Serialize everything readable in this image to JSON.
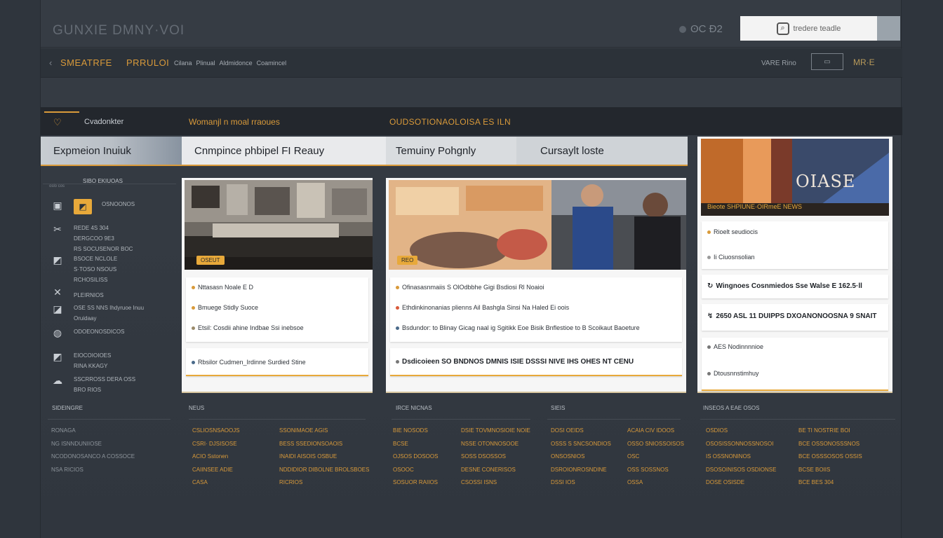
{
  "header": {
    "brand": "GUNXIE DMNY·VOI",
    "status": "ʘC Ð2",
    "search_placeholder": "tredere teadle"
  },
  "nav": {
    "back": "‹",
    "main": "SMEATRFE",
    "secondary": "PRRULOI",
    "links": [
      "Cilana",
      "Plinual",
      "Aldmidonce",
      "Coamincel"
    ],
    "user": "VARE Rino",
    "chip": "▭",
    "right": "MR·E"
  },
  "strip": {
    "title": "Cvadonkter",
    "middle": "Womanjl n moal rraoues",
    "right": "OUDSOTIONAOLOISA ES ILN"
  },
  "tabs": [
    "Expmeion Inuiuk",
    "Cnmpince phbipel FI Reauy",
    "Temuiny Pohgnly",
    "Cursaylt loste"
  ],
  "sidebar": {
    "heading": "SIBO EKIUOAS",
    "sub": "oslo cos",
    "rows": [
      {
        "icon": "image-icon",
        "glyph": "▣",
        "lines": [
          "OSNOONOS"
        ],
        "active": true
      },
      {
        "icon": "tool-icon",
        "glyph": "✂",
        "lines": [
          "REDE 4S 304",
          "DERGCOO 9E3",
          "RS SOCUSENOR BOC"
        ]
      },
      {
        "icon": "flag-icon",
        "glyph": "◩",
        "lines": [
          "BSOCE NCLOLE",
          "S·TOSO NSOUS",
          "RCHOSILISS"
        ]
      },
      {
        "icon": "cross-icon",
        "glyph": "✕",
        "lines": [
          "PLEIRNIOS"
        ]
      },
      {
        "icon": "chart-icon",
        "glyph": "◪",
        "lines": [
          "OSE SS NNS Ihdyruoe Inuu",
          "Oruidaay"
        ]
      },
      {
        "icon": "globe-icon",
        "glyph": "◍",
        "lines": [
          "ODOEONOSDICOS"
        ]
      },
      {
        "icon": "doc-icon",
        "glyph": "◩",
        "lines": [
          "EIOCOIOIOES",
          "RINA KKAGY"
        ]
      },
      {
        "icon": "cloud-icon",
        "glyph": "☁",
        "lines": [
          "SSCRROSS DERA OSS",
          "BRO RIOS"
        ]
      }
    ]
  },
  "cards": [
    {
      "badge": "OSEUT",
      "items": [
        {
          "text": "Nttasasn Noale E  D",
          "bold": false
        },
        {
          "text": "Bmuege Stidly Suoce",
          "bold": false
        },
        {
          "text": "Etsil: Cosdii ahine Indbae  Ssi inebsoe",
          "bold": false
        },
        {
          "text": "Rbsilor  Cudmen_Irdinne Surdied Stine",
          "bold": false
        }
      ]
    },
    {
      "badge": "REO",
      "items": [
        {
          "text": "Ofinasasnmaiis  S  OlOdbbhe  Gigi  Bsdiosi  Rl Noaioi",
          "bold": false
        },
        {
          "text": "Ethdinkinonanias plienns Ail Bashgla  Sinsi Na Haled Ei oois",
          "bold": false
        },
        {
          "text": "Bsdundor: to Blinay  Gicag naal ig  Sgitikk  Eoe Bisik  Bnflestioe to B Scoikaut Baoeture",
          "bold": false
        },
        {
          "text": "Dsdicoieen  SO  BNDNOS DMNIS ISIE DSSSI NIVE  IHS  OHES NT CENU",
          "bold": true
        }
      ]
    },
    {
      "caption": "OIASE",
      "subcaption": "Bieote  SHPIUNE·OIRmeE  NEWS",
      "items": [
        {
          "text": "Rioelt seudiocis",
          "bold": false
        },
        {
          "text": "Ii Ciuosnsolian",
          "bold": false
        },
        {
          "text": "Wingnoes  Cosnmiedos Sse  Walse  E 162.5·ll",
          "bold": true
        },
        {
          "text": "2650  ASL 11  DUIPPS  DXOANONOOSNA 9 SNAIT",
          "bold": true
        },
        {
          "text": "AES Nodinnnnioe",
          "bold": false
        },
        {
          "text": "Dtousnnstimhuy",
          "bold": false
        }
      ]
    }
  ],
  "footer": {
    "columns": [
      {
        "head": "SIDEINGRE",
        "lines": [
          "RONAGA",
          "NG ISNNDUNIIOSE",
          "NCODONOSANCO A COSSOCE",
          "NSA RICIOS"
        ],
        "tone": "grey"
      },
      {
        "head": "NEUS",
        "lines": [
          "CSLIOSNSAOOJS",
          "CSRI· DJSISOSE",
          "ACIO  Sstonen",
          "CAIINSEE ADIE",
          "CASA"
        ],
        "tone": "orange"
      },
      {
        "head": "",
        "lines": [
          "SSONIMAOE AGIS",
          "BESS  SSEDIONSOAOIS",
          "INAIDI  AISOIS OSBUE",
          "NDDIDIOR DIBOLNE  BROLSBOES",
          "RICRIOS"
        ],
        "tone": "orange"
      },
      {
        "head": "IRCE  NICNAS",
        "lines": [
          "BIE NOSODS",
          "BCSE",
          "OJSOS  DOSOOS",
          "OSOOC",
          "SOSUOR RAIIOS"
        ],
        "tone": "orange"
      },
      {
        "head": "",
        "lines": [
          "DSIE  TOVMNOSIOIE NOIE",
          "NSSE  OTONNOSOOE",
          "SOSS  DSOSSOS",
          "DESNE  CONERISOS",
          "CSOSSI  ISNS"
        ],
        "tone": "orange"
      },
      {
        "head": "SIEIS",
        "lines": [
          "DOSI  OEIDS",
          "OSSS  S  SNCSONDIOS",
          "ONSOSNIOS",
          "DSROIONROSNDINE",
          "DSSI  IOS"
        ],
        "tone": "orange"
      },
      {
        "head": "",
        "lines": [
          "ACAIA CIV IDOOS",
          "OSSO  SNIOSSOISOS",
          "OSC",
          "OSS  SOSSNOS",
          "OSSA"
        ],
        "tone": "orange"
      },
      {
        "head": "INSEOS  A EAE  OSOS",
        "lines": [
          "OSDIOS",
          "OSOSISSONNOSSNOSOI",
          "IS  OSSNONINOS",
          "DSOSOINISOS  OSDIONSE",
          "DOSE  OSISDE"
        ],
        "tone": "orange"
      },
      {
        "head": "",
        "lines": [
          "BE  TI  NOSTRIE BOI",
          "BCE  OSSONOSSSNOS",
          "BCE  OSSSOSOS  OSSIS",
          "BCSE  BOIIS",
          "BCE  BES  304"
        ],
        "tone": "orange"
      }
    ]
  },
  "colors": {
    "accent": "#d99a3a",
    "background": "#2f353d",
    "panel": "#f6f6f6"
  }
}
